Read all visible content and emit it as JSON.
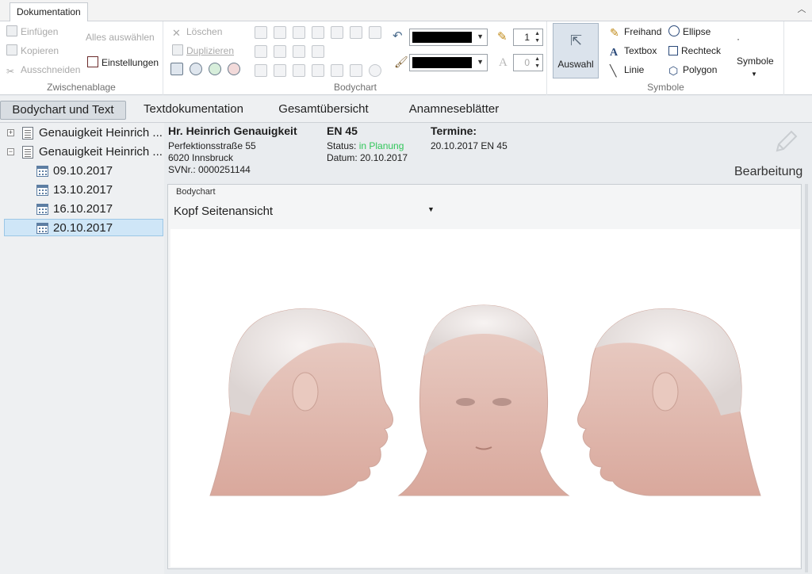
{
  "ribbon_tab": {
    "label": "Dokumentation"
  },
  "zwischenablage": {
    "einfuegen": "Einfügen",
    "kopieren": "Kopieren",
    "ausschneiden": "Ausschneiden",
    "alles_auswaehlen": "Alles auswählen",
    "einstellungen": "Einstellungen",
    "label": "Zwischenablage"
  },
  "bodychart_group": {
    "loeschen": "Löschen",
    "duplizieren": "Duplizieren",
    "label": "Bodychart",
    "stroke_width": "1",
    "font_size": "0",
    "line_color": "#000000",
    "fill_color": "#000000"
  },
  "symbole_group": {
    "auswahl": "Auswahl",
    "freihand": "Freihand",
    "textbox": "Textbox",
    "linie": "Linie",
    "ellipse": "Ellipse",
    "rechteck": "Rechteck",
    "polygon": "Polygon",
    "symbole": "Symbole",
    "label": "Symbole"
  },
  "subtabs": [
    "Bodychart und Text",
    "Textdokumentation",
    "Gesamtübersicht",
    "Anamneseblätter"
  ],
  "tree": {
    "items": [
      {
        "label": "Genauigkeit Heinrich ...",
        "expander": "+"
      },
      {
        "label": "Genauigkeit Heinrich ...",
        "expander": "−"
      }
    ],
    "dates": [
      "09.10.2017",
      "13.10.2017",
      "16.10.2017",
      "20.10.2017"
    ]
  },
  "patient": {
    "name": "Hr. Heinrich Genauigkeit",
    "street": "Perfektionsstraße 55",
    "city": "6020 Innsbruck",
    "svnr": "SVNr.: 0000251144"
  },
  "code": {
    "title": "EN 45",
    "status_label": "Status: ",
    "status_value": "in Planung",
    "date": "Datum: 20.10.2017"
  },
  "termine": {
    "title": "Termine:",
    "entry": "20.10.2017 EN 45"
  },
  "bearbeitung": "Bearbeitung",
  "bodychart_panel": {
    "title": "Bodychart",
    "view": "Kopf Seitenansicht"
  },
  "colors": {
    "status": "#31c65a",
    "selection": "#cfe6f7"
  }
}
